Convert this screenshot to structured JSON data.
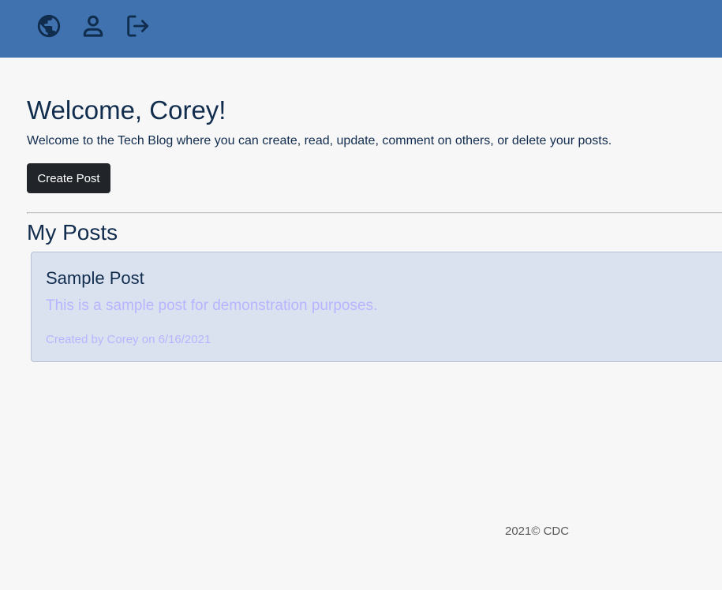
{
  "nav": {
    "icons": [
      "globe-icon",
      "user-icon",
      "logout-icon"
    ],
    "background": "#3f72af",
    "icon_color": "#112d4e"
  },
  "welcome": {
    "title": "Welcome, Corey!",
    "text": "Welcome to the Tech Blog where you can create, read, update, comment on others, or delete your posts."
  },
  "actions": {
    "create_label": "Create Post"
  },
  "posts_section": {
    "title": "My Posts",
    "posts": [
      {
        "title": "Sample Post",
        "body": "This is a sample post for demonstration purposes.",
        "meta": "Created by Corey on 6/16/2021"
      }
    ]
  },
  "footer": {
    "text": "2021© CDC"
  },
  "colors": {
    "page_background": "#f8f7f8",
    "heading": "#112d4e",
    "button": "#212529",
    "card_background": "#dbe2ef",
    "card_muted_text": "#b9b4ff"
  }
}
